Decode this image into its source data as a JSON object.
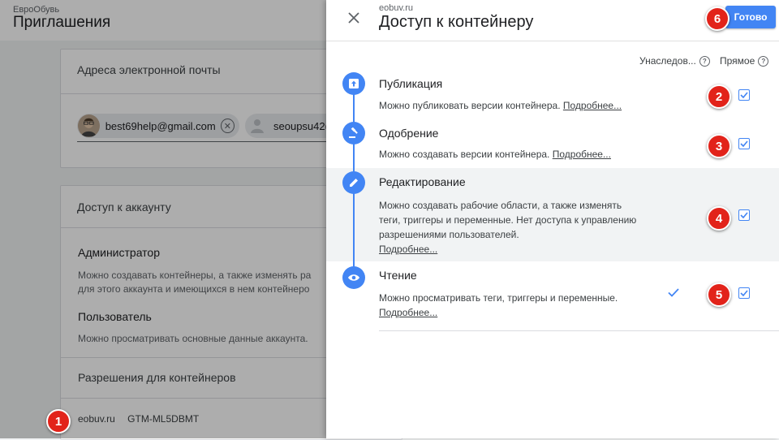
{
  "background": {
    "brand": "ЕвроОбувь",
    "title": "Приглашения",
    "email_card_title": "Адреса электронной почты",
    "chips": [
      {
        "email": "best69help@gmail.com"
      },
      {
        "email": "seoupsu42("
      }
    ],
    "account_access_title": "Доступ к аккаунту",
    "roles": [
      {
        "title": "Администратор",
        "desc_1": "Можно создавать контейнеры, а также изменять ра",
        "desc_2": "для этого аккаунта и имеющихся в нем контейнеро"
      },
      {
        "title": "Пользователь",
        "desc_1": "Можно просматривать основные данные аккаунта."
      }
    ],
    "container_perms_title": "Разрешения для контейнеров",
    "footer_site": "eobuv.ru",
    "footer_id": "GTM-ML5DBMT"
  },
  "panel": {
    "subtitle": "eobuv.ru",
    "title": "Доступ к контейнеру",
    "done_label": "Готово",
    "col_inherited": "Унаследов...",
    "col_direct": "Прямое",
    "permissions": [
      {
        "title": "Публикация",
        "desc": "Можно публиковать версии контейнера.",
        "more": "Подробнее...",
        "checked": true,
        "icon": "publish-icon"
      },
      {
        "title": "Одобрение",
        "desc": "Можно создавать версии контейнера.",
        "more": "Подробнее...",
        "checked": true,
        "icon": "gavel-icon"
      },
      {
        "title": "Редактирование",
        "desc": "Можно создавать рабочие области, а также изменять теги, триггеры и переменные. Нет доступа к управлению разрешениями пользователей.",
        "more": "Подробнее...",
        "checked": true,
        "icon": "pencil-icon"
      },
      {
        "title": "Чтение",
        "desc": "Можно просматривать теги, триггеры и переменные.",
        "more": "Подробнее...",
        "checked": true,
        "inherited": true,
        "icon": "eye-icon"
      }
    ]
  },
  "badges": [
    "1",
    "2",
    "3",
    "4",
    "5",
    "6"
  ],
  "colors": {
    "accent": "#4285f4",
    "badge": "#e2231a",
    "highlight_row": "#f1f3f4"
  }
}
